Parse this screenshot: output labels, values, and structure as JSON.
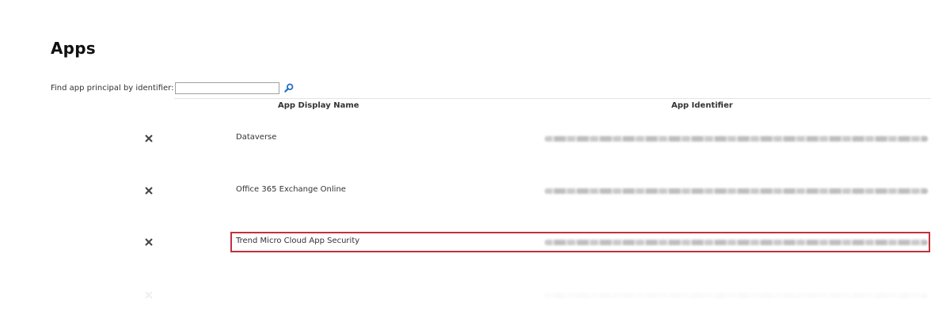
{
  "page": {
    "title": "Apps"
  },
  "search": {
    "label": "Find app principal by identifier:",
    "value": "",
    "placeholder": "",
    "button_icon": "search-icon"
  },
  "table": {
    "columns": [
      "App Display Name",
      "App Identifier"
    ],
    "rows": [
      {
        "name": "Dataverse",
        "identifier_redacted": true,
        "delete_icon": "close-icon"
      },
      {
        "name": "Office 365 Exchange Online",
        "identifier_redacted": true,
        "delete_icon": "close-icon"
      },
      {
        "name": "Trend Micro Cloud App Security",
        "identifier_redacted": true,
        "delete_icon": "close-icon",
        "highlighted": true
      },
      {
        "name": "",
        "identifier_redacted": true,
        "delete_icon": "close-icon",
        "faded": true
      }
    ]
  },
  "colors": {
    "highlight_border": "#c0323c",
    "search_icon": "#1f6fc4",
    "delete_icon": "#444444"
  }
}
